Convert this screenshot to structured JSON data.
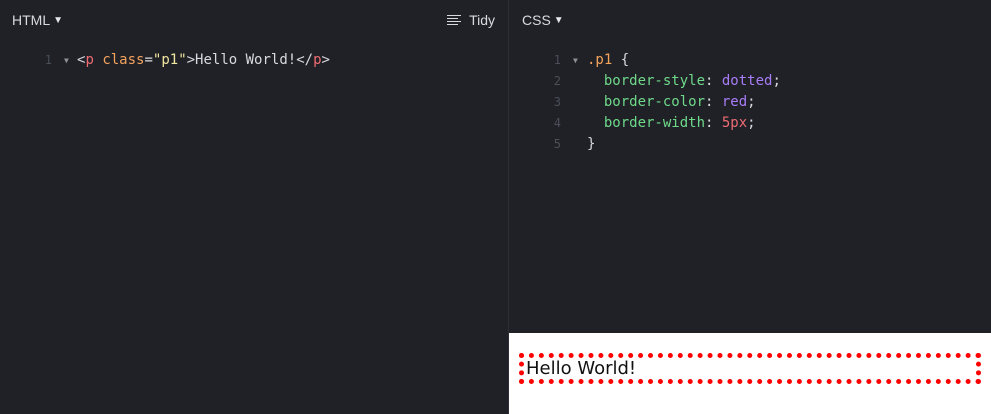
{
  "html_pane": {
    "lang_label": "HTML",
    "tidy_label": "Tidy",
    "lines": [
      {
        "number": "1",
        "tokens": [
          {
            "t": "<",
            "k": "punc"
          },
          {
            "t": "p",
            "k": "tag"
          },
          {
            "t": " ",
            "k": "punc"
          },
          {
            "t": "class",
            "k": "attr"
          },
          {
            "t": "=",
            "k": "punc"
          },
          {
            "t": "\"p1\"",
            "k": "str"
          },
          {
            "t": ">Hello World!</",
            "k": "punc"
          },
          {
            "t": "p",
            "k": "tag"
          },
          {
            "t": ">",
            "k": "punc"
          }
        ]
      }
    ]
  },
  "css_pane": {
    "lang_label": "CSS",
    "lines": [
      {
        "number": "1",
        "tokens": [
          {
            "t": ".p1",
            "k": "selector"
          },
          {
            "t": " {",
            "k": "punc"
          }
        ]
      },
      {
        "number": "2",
        "tokens": [
          {
            "t": "  ",
            "k": "punc"
          },
          {
            "t": "border-style",
            "k": "prop"
          },
          {
            "t": ": ",
            "k": "punc"
          },
          {
            "t": "dotted",
            "k": "value"
          },
          {
            "t": ";",
            "k": "punc"
          }
        ]
      },
      {
        "number": "3",
        "tokens": [
          {
            "t": "  ",
            "k": "punc"
          },
          {
            "t": "border-color",
            "k": "prop"
          },
          {
            "t": ": ",
            "k": "punc"
          },
          {
            "t": "red",
            "k": "value"
          },
          {
            "t": ";",
            "k": "punc"
          }
        ]
      },
      {
        "number": "4",
        "tokens": [
          {
            "t": "  ",
            "k": "punc"
          },
          {
            "t": "border-width",
            "k": "prop"
          },
          {
            "t": ": ",
            "k": "punc"
          },
          {
            "t": "5px",
            "k": "num"
          },
          {
            "t": ";",
            "k": "punc"
          }
        ]
      },
      {
        "number": "5",
        "tokens": [
          {
            "t": "}",
            "k": "punc"
          }
        ]
      }
    ]
  },
  "preview": {
    "text": "Hello World!"
  },
  "icons": {
    "caret": "caret-down-icon",
    "tidy": "align-lines-icon",
    "fold": "fold-arrow-icon"
  },
  "colors": {
    "editor_bg": "#1f2126",
    "preview_bg": "#ffffff",
    "border_red": "#ff0000",
    "token_tag": "#ef6b73",
    "token_attr": "#f5a25d",
    "token_string": "#f3e6a0",
    "token_property": "#6fd98a",
    "token_value": "#a97cf8"
  }
}
